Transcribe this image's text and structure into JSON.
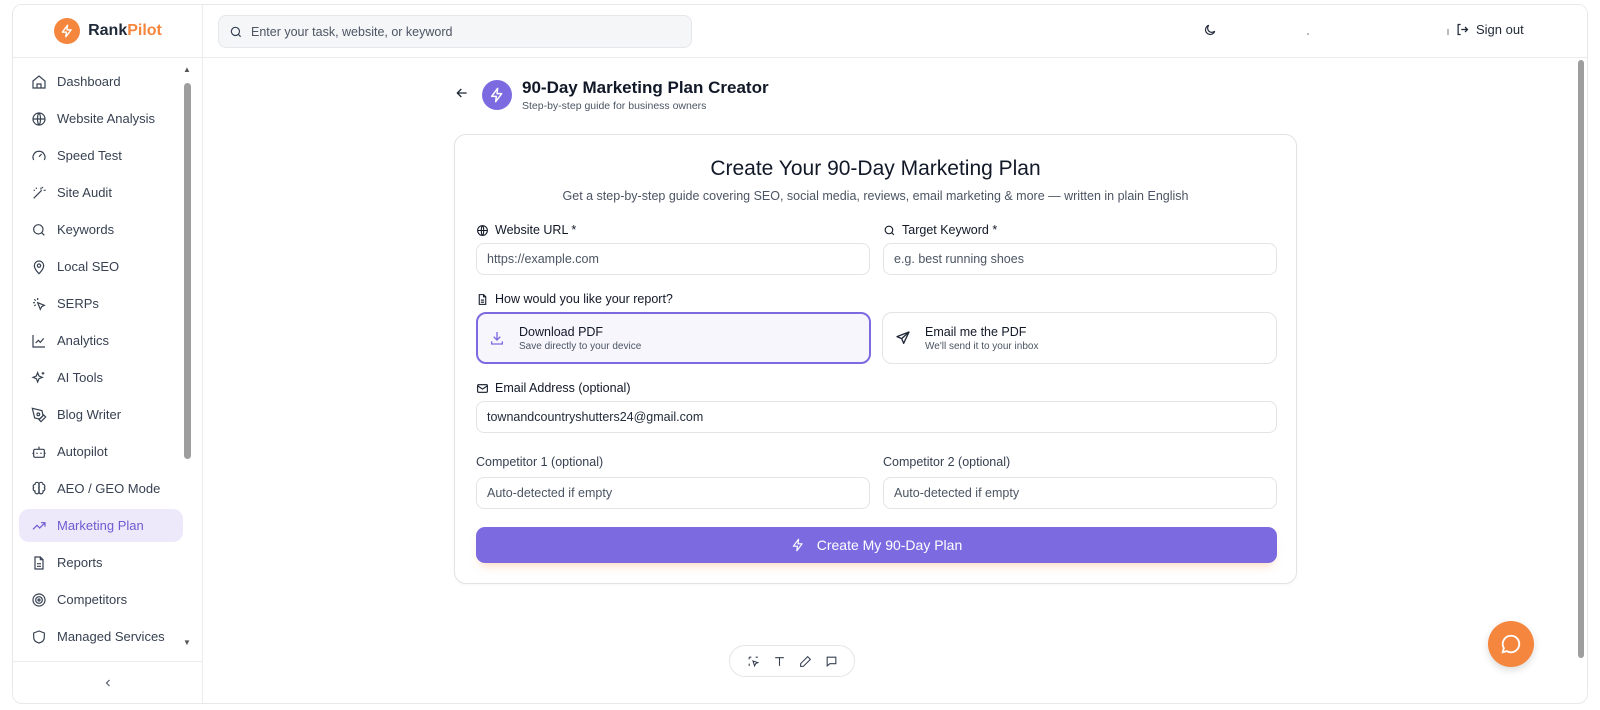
{
  "brand": {
    "name_part1": "Rank",
    "name_part2": "Pilot",
    "accent_color": "#f5863d"
  },
  "header": {
    "search_placeholder": "Enter your task, website, or keyword",
    "signout_label": "Sign out"
  },
  "sidebar": {
    "items": [
      {
        "label": "Dashboard",
        "icon": "home-icon"
      },
      {
        "label": "Website Analysis",
        "icon": "globe-icon"
      },
      {
        "label": "Speed Test",
        "icon": "gauge-icon"
      },
      {
        "label": "Site Audit",
        "icon": "wand-icon"
      },
      {
        "label": "Keywords",
        "icon": "search-icon"
      },
      {
        "label": "Local SEO",
        "icon": "map-pin-icon"
      },
      {
        "label": "SERPs",
        "icon": "cursor-click-icon"
      },
      {
        "label": "Analytics",
        "icon": "line-chart-icon"
      },
      {
        "label": "AI Tools",
        "icon": "sparkles-icon"
      },
      {
        "label": "Blog Writer",
        "icon": "pen-tool-icon"
      },
      {
        "label": "Autopilot",
        "icon": "bot-icon"
      },
      {
        "label": "AEO / GEO Mode",
        "icon": "brain-icon"
      },
      {
        "label": "Marketing Plan",
        "icon": "trending-up-icon",
        "active": true
      },
      {
        "label": "Reports",
        "icon": "file-text-icon"
      },
      {
        "label": "Competitors",
        "icon": "target-icon"
      },
      {
        "label": "Managed Services",
        "icon": "shield-icon"
      }
    ]
  },
  "page": {
    "title": "90-Day Marketing Plan Creator",
    "subtitle": "Step-by-step guide for business owners"
  },
  "form": {
    "heading": "Create Your 90-Day Marketing Plan",
    "description": "Get a step-by-step guide covering SEO, social media, reviews, email marketing & more — written in plain English",
    "website_label": "Website URL *",
    "website_placeholder": "https://example.com",
    "keyword_label": "Target Keyword *",
    "keyword_placeholder": "e.g. best running shoes",
    "report_label": "How would you like your report?",
    "options": [
      {
        "title": "Download PDF",
        "subtitle": "Save directly to your device",
        "selected": true
      },
      {
        "title": "Email me the PDF",
        "subtitle": "We'll send it to your inbox",
        "selected": false
      }
    ],
    "email_label": "Email Address (optional)",
    "email_value": "townandcountryshutters24@gmail.com",
    "competitor1_label": "Competitor 1 (optional)",
    "competitor1_placeholder": "Auto-detected if empty",
    "competitor2_label": "Competitor 2 (optional)",
    "competitor2_placeholder": "Auto-detected if empty",
    "submit_label": "Create My 90-Day Plan"
  },
  "colors": {
    "primary": "#7c6be0",
    "active_bg": "#ede9fb",
    "chat_fab": "#f5863d"
  }
}
